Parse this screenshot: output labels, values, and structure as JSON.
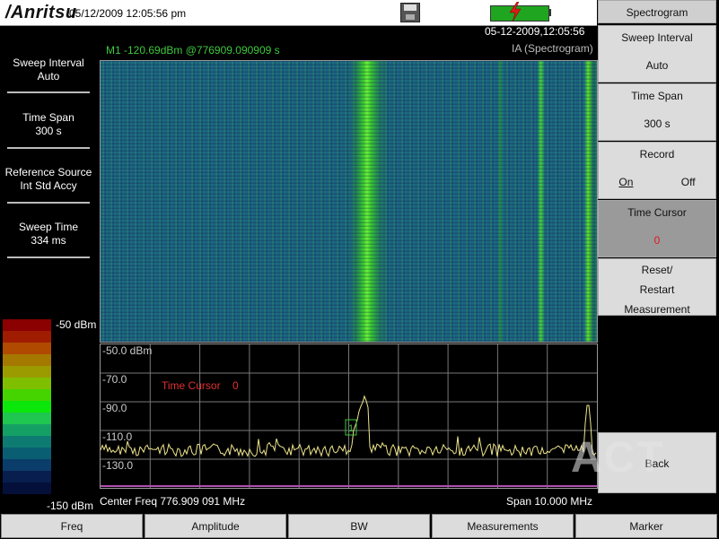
{
  "topbar": {
    "logo": "/Anritsu",
    "datetime": "05/12/2009 12:05:56 pm"
  },
  "header": {
    "timestamp": "05-12-2009,12:05:56",
    "mode": "IA (Spectrogram)",
    "marker_readout": "M1 -120.69dBm @776909.090909 s"
  },
  "left_panel": {
    "params": [
      {
        "label": "Sweep Interval",
        "value": "Auto"
      },
      {
        "label": "Time Span",
        "value": "300 s"
      },
      {
        "label": "Reference Source",
        "value": "Int Std Accy"
      },
      {
        "label": "Sweep Time",
        "value": "334 ms"
      }
    ],
    "color_scale": {
      "top": "-50 dBm",
      "bottom": "-150 dBm",
      "colors": [
        "#8b0000",
        "#a01c00",
        "#b04a00",
        "#a57800",
        "#9b9b00",
        "#7fbf00",
        "#45d400",
        "#0be60b",
        "#1fc64f",
        "#14a064",
        "#0e7b72",
        "#0a5e72",
        "#0a3d6a",
        "#071e4e",
        "#05103a"
      ]
    }
  },
  "plot": {
    "y_labels": [
      "-50.0 dBm",
      "-70.0",
      "-90.0",
      "-110.0",
      "-130.0"
    ],
    "time_cursor_label": "Time Cursor",
    "time_cursor_value": "0",
    "marker_label": "1",
    "center_freq": "Center Freq 776.909 091 MHz",
    "span": "Span 10.000 MHz"
  },
  "softkeys": {
    "title": "Spectrogram",
    "sweep_interval": {
      "label": "Sweep Interval",
      "value": "Auto"
    },
    "time_span": {
      "label": "Time Span",
      "value": "300 s"
    },
    "record": {
      "label": "Record",
      "on": "On",
      "off": "Off"
    },
    "time_cursor": {
      "label": "Time Cursor",
      "value": "0"
    },
    "reset": {
      "line1": "Reset/",
      "line2": "Restart",
      "line3": "Measurement"
    },
    "back": "Back"
  },
  "bottom_keys": [
    "Freq",
    "Amplitude",
    "BW",
    "Measurements",
    "Marker"
  ],
  "colors": {
    "marker_green": "#3ec83e",
    "cursor_red": "#e03030",
    "trace_yellow": "#f0e68c",
    "battery_green": "#1fa51f",
    "active_softkey": "#9a9a9a"
  }
}
